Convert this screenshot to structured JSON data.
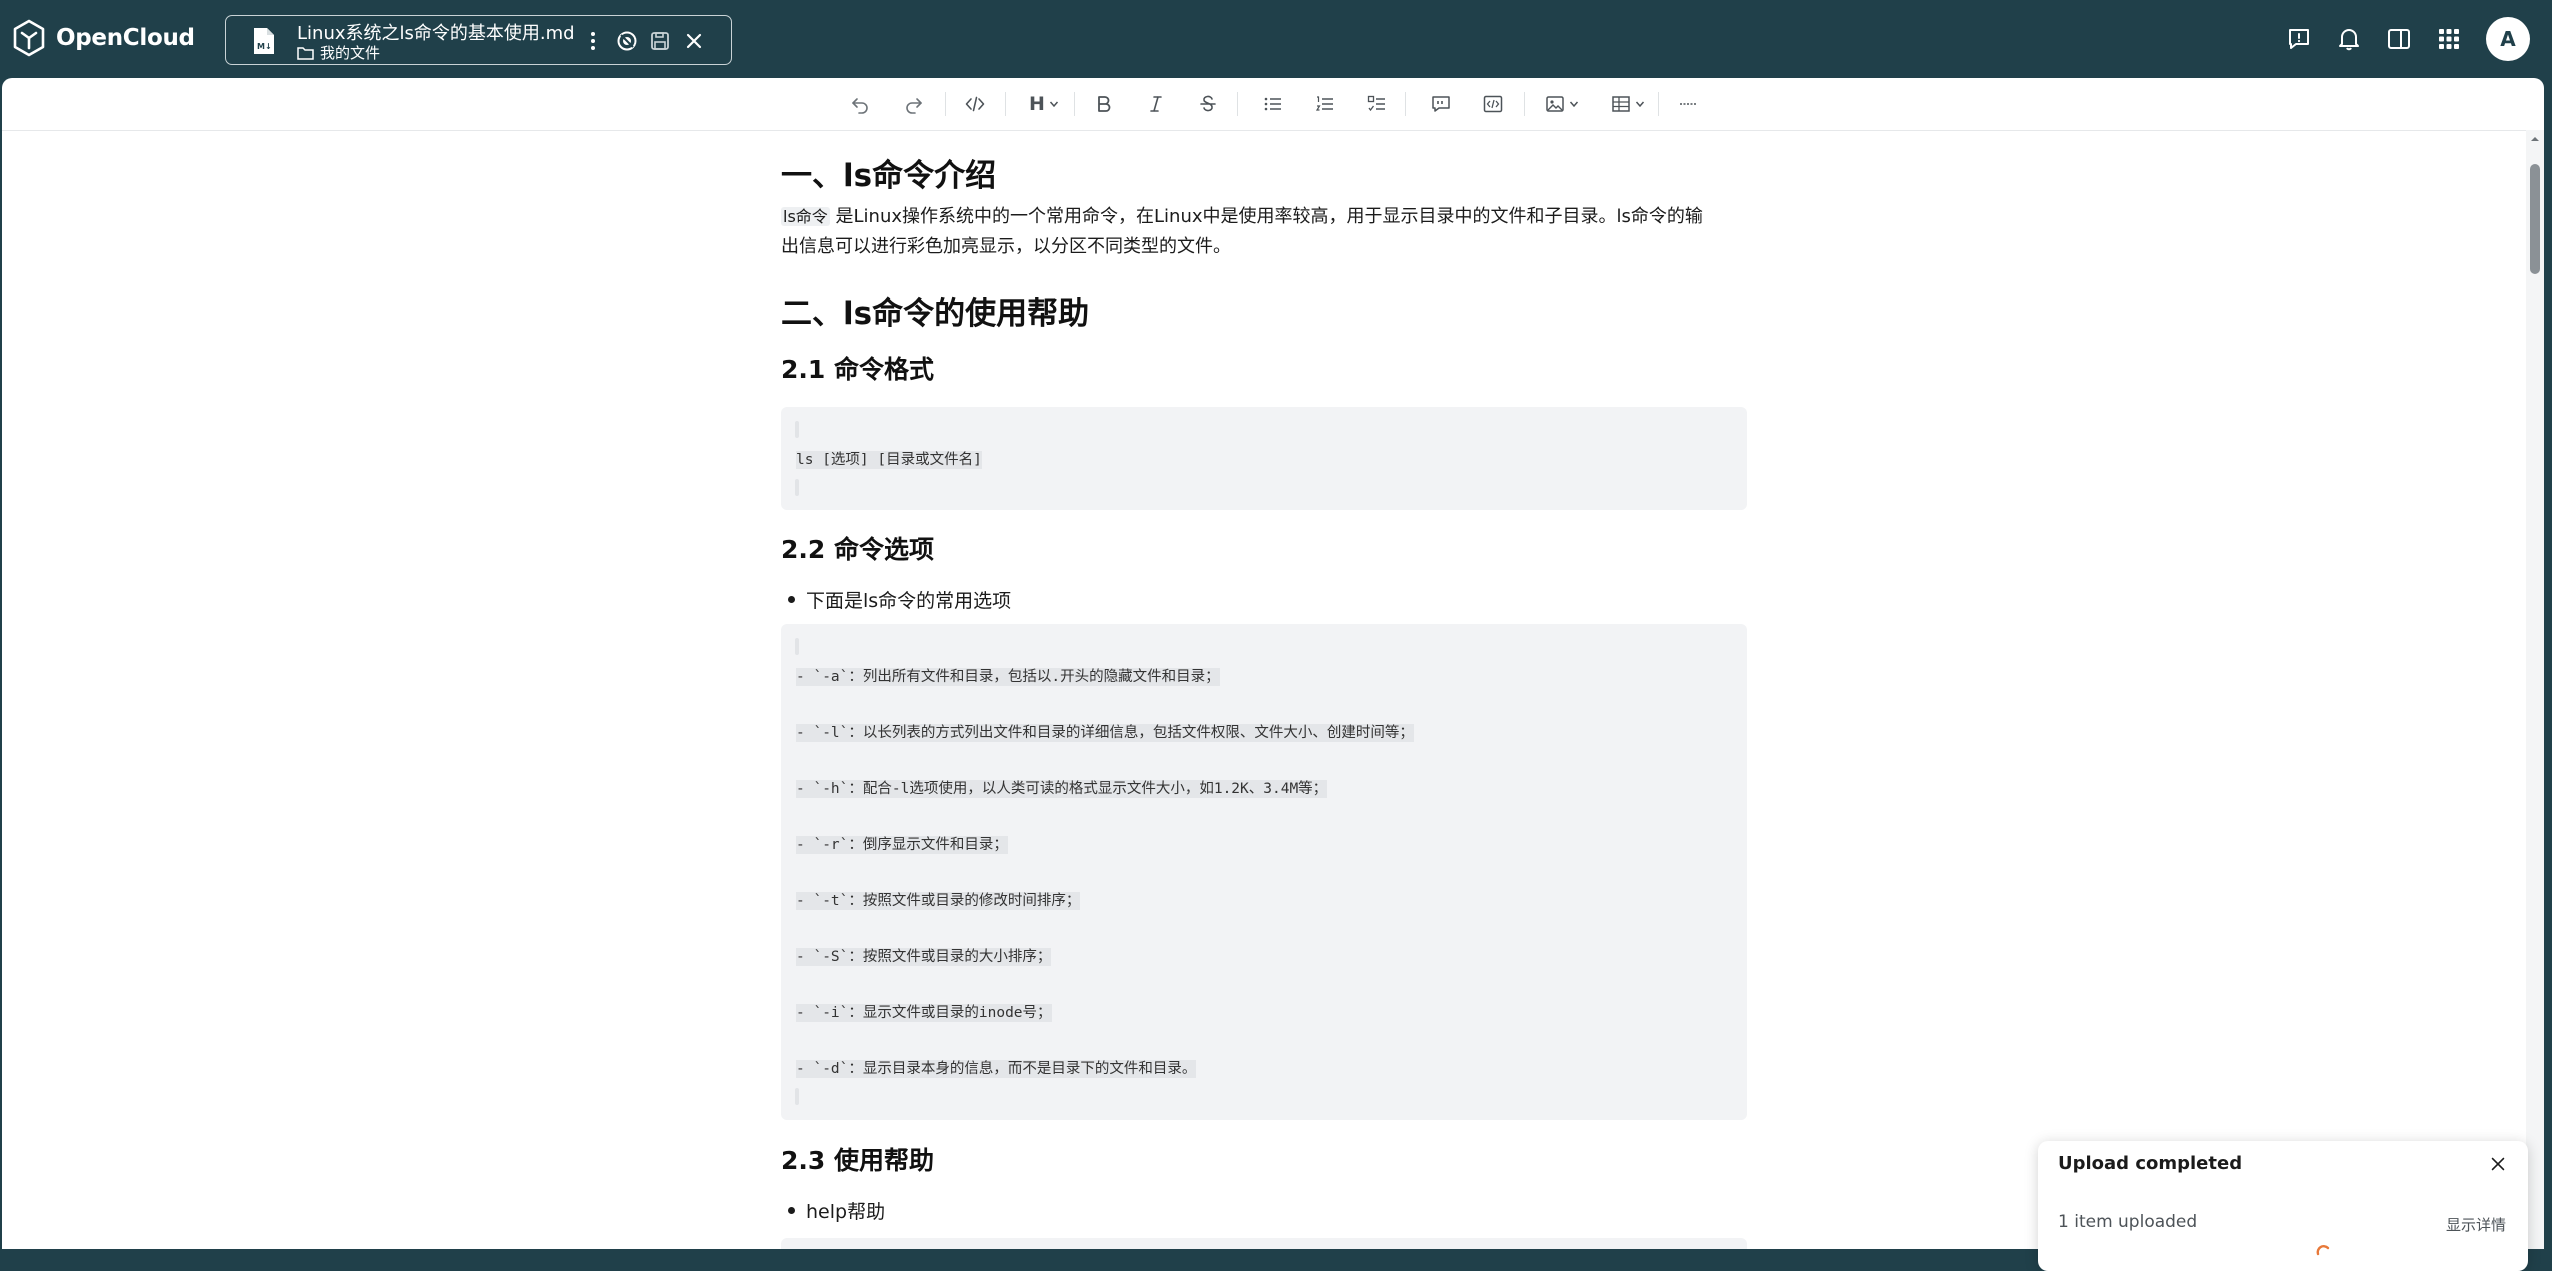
{
  "app": {
    "name": "OpenCloud"
  },
  "file": {
    "name": "Linux系统之ls命令的基本使用.md",
    "location": "我的文件"
  },
  "user": {
    "avatar_initial": "A"
  },
  "toolbar": {
    "heading_label": "H"
  },
  "document": {
    "h1_intro": "一、ls命令介绍",
    "intro_code": "ls命令",
    "intro_text_line1": " 是Linux操作系统中的一个常用命令，在Linux中是使用率较高，用于显示目录中的文件和子目录。ls命令的输",
    "intro_text_line2": "出信息可以进行彩色加亮显示，以分区不同类型的文件。",
    "h1_help": "二、ls命令的使用帮助",
    "h2_format": "2.1 命令格式",
    "format_code": "ls [选项] [目录或文件名]",
    "h2_options": "2.2 命令选项",
    "options_bullet": "下面是ls命令的常用选项",
    "options_code": [
      "- `-a`：列出所有文件和目录，包括以.开头的隐藏文件和目录；",
      "- `-l`：以长列表的方式列出文件和目录的详细信息，包括文件权限、文件大小、创建时间等；",
      "- `-h`：配合-l选项使用，以人类可读的格式显示文件大小，如1.2K、3.4M等；",
      "- `-r`：倒序显示文件和目录；",
      "- `-t`：按照文件或目录的修改时间排序；",
      "- `-S`：按照文件或目录的大小排序；",
      "- `-i`：显示文件或目录的inode号；",
      "- `-d`：显示目录本身的信息，而不是目录下的文件和目录。"
    ],
    "h2_usage": "2.3 使用帮助",
    "usage_bullet": "help帮助"
  },
  "toast": {
    "title": "Upload completed",
    "count": "1 item uploaded",
    "details": "显示详情"
  }
}
